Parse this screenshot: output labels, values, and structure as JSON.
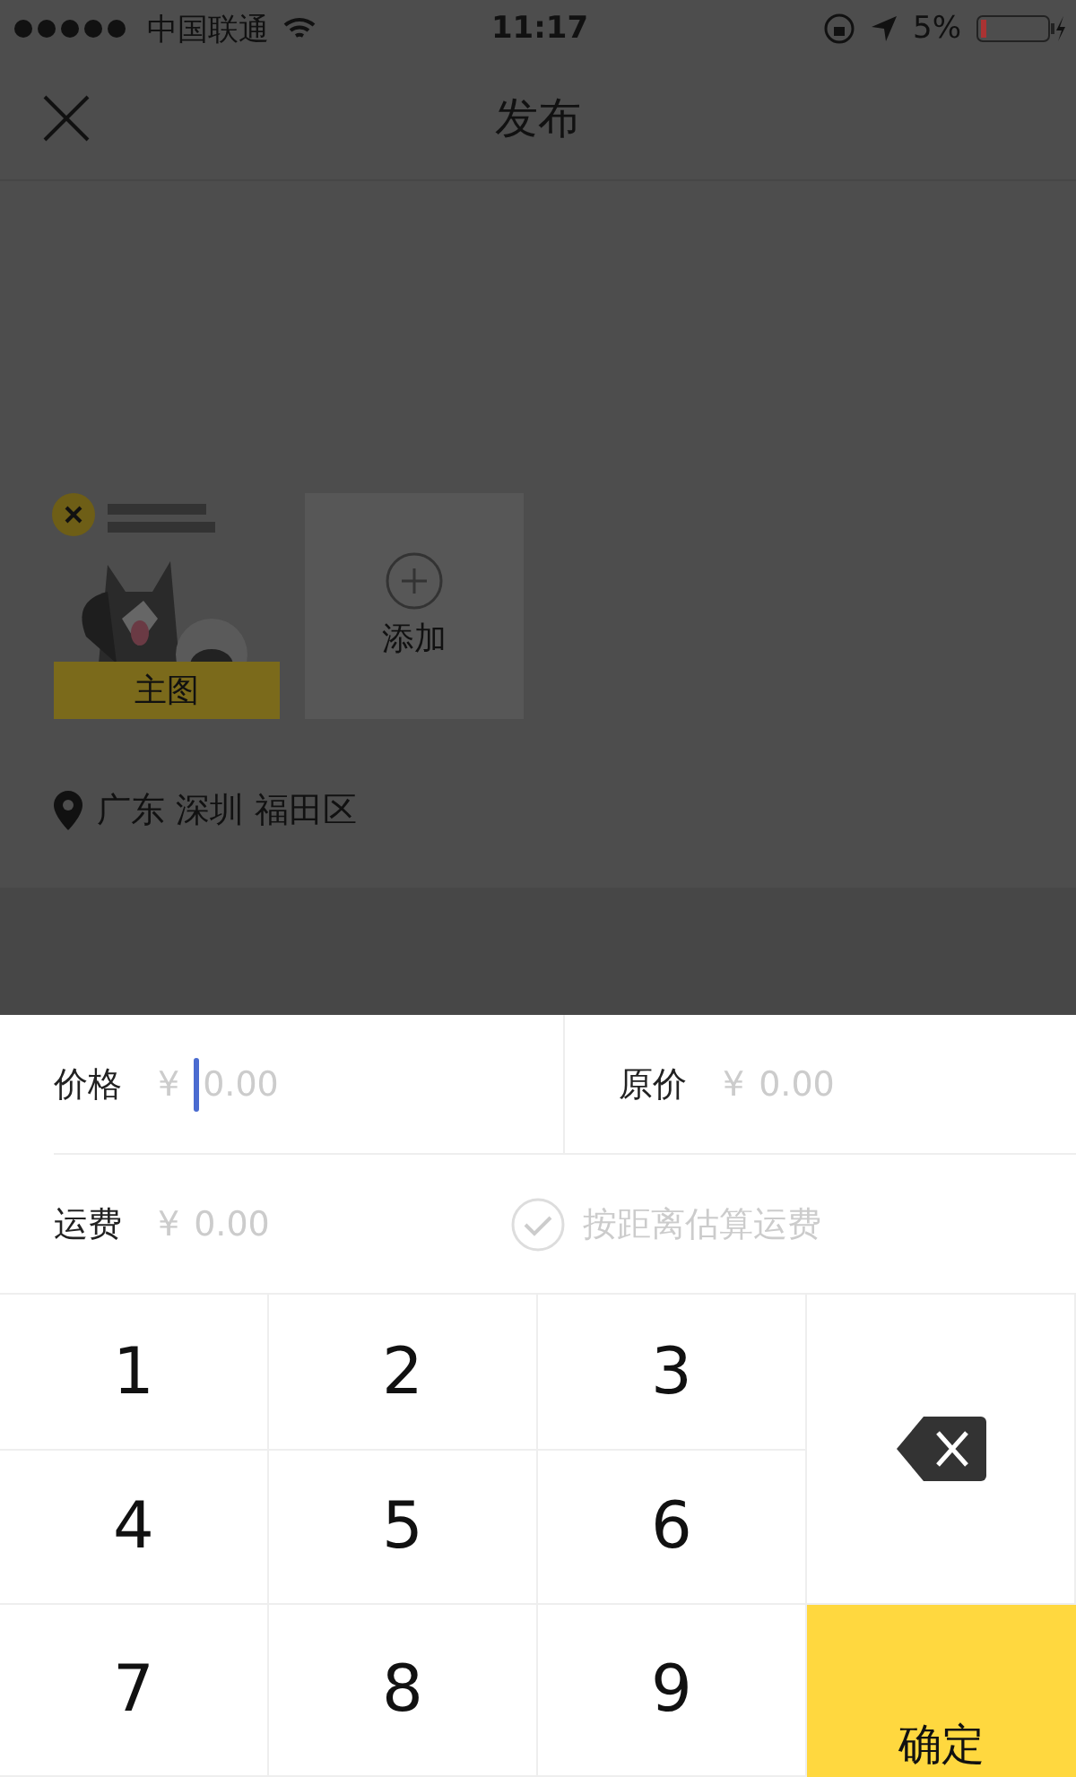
{
  "status_bar": {
    "carrier": "中国联通",
    "time": "11:17",
    "battery": "5%"
  },
  "nav": {
    "title": "发布"
  },
  "photos": [
    {
      "kind": "picture",
      "badge": "主图"
    },
    {
      "kind": "add",
      "label": "添加"
    }
  ],
  "location": "广东 深圳 福田区",
  "form": {
    "fields": [
      {
        "label": "价格",
        "currency": "¥",
        "placeholder": "0.00",
        "focused": true
      },
      {
        "label": "原价",
        "currency": "¥",
        "placeholder": "0.00",
        "focused": false
      },
      {
        "label": "运费",
        "currency": "¥",
        "placeholder": "0.00",
        "focused": false
      }
    ],
    "estimate": {
      "label": "按距离估算运费",
      "checked": false
    }
  },
  "keypad": {
    "keys": [
      {
        "kind": "digit",
        "label": "1"
      },
      {
        "kind": "digit",
        "label": "2"
      },
      {
        "kind": "digit",
        "label": "3"
      },
      {
        "kind": "delete"
      },
      {
        "kind": "digit",
        "label": "4"
      },
      {
        "kind": "digit",
        "label": "5"
      },
      {
        "kind": "digit",
        "label": "6"
      },
      {
        "kind": "digit",
        "label": "7"
      },
      {
        "kind": "digit",
        "label": "8"
      },
      {
        "kind": "digit",
        "label": "9"
      },
      {
        "kind": "confirm",
        "label": "确定"
      }
    ]
  }
}
